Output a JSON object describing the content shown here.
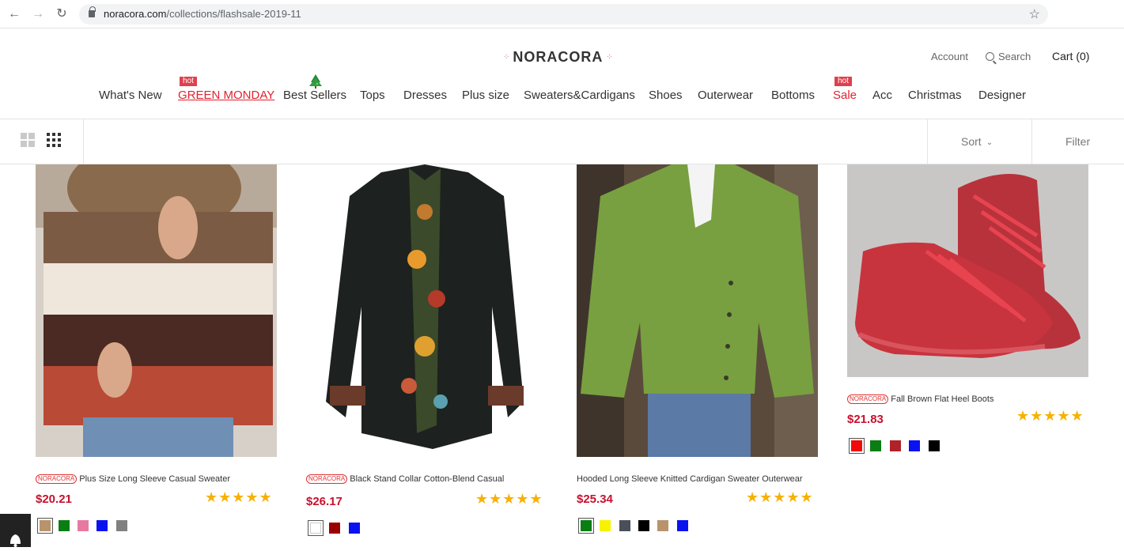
{
  "browser": {
    "url_host": "noracora.com",
    "url_path": "/collections/flashsale-2019-11"
  },
  "header": {
    "logo": "NORACORA",
    "account": "Account",
    "search": "Search",
    "cart": "Cart (0)"
  },
  "nav": [
    {
      "label": "What's New"
    },
    {
      "label": "GREEN MONDAY",
      "badge": "hot"
    },
    {
      "label": "Best Sellers"
    },
    {
      "label": "Tops"
    },
    {
      "label": "Dresses"
    },
    {
      "label": "Plus size"
    },
    {
      "label": "Sweaters&Cardigans"
    },
    {
      "label": "Shoes"
    },
    {
      "label": "Outerwear"
    },
    {
      "label": "Bottoms"
    },
    {
      "label": "Sale",
      "badge": "hot"
    },
    {
      "label": "Acc"
    },
    {
      "label": "Christmas"
    },
    {
      "label": "Designer"
    }
  ],
  "toolbar": {
    "sort": "Sort",
    "filter": "Filter"
  },
  "products": [
    {
      "brand": "NORACORA",
      "title": "Plus Size Long Sleeve Casual Sweater",
      "price": "$20.21",
      "rating": 5,
      "swatches": [
        "#b8936b",
        "#0a7d13",
        "#e87aa2",
        "#0a12f0",
        "#808080"
      ]
    },
    {
      "brand": "NORACORA",
      "title": "Black Stand Collar Cotton-Blend Casual",
      "price": "$26.17",
      "rating": 5,
      "swatches": [
        "#ffffff",
        "#9b0000",
        "#0a12f0"
      ]
    },
    {
      "brand": "",
      "title": "Hooded Long Sleeve Knitted Cardigan Sweater Outerwear",
      "price": "$25.34",
      "rating": 5,
      "swatches": [
        "#0a7d13",
        "#f7f200",
        "#4a4f59",
        "#000000",
        "#b8936b",
        "#0a12f0"
      ]
    },
    {
      "brand": "NORACORA",
      "title": "Fall Brown Flat Heel Boots",
      "price": "$21.83",
      "rating": 5,
      "swatches": [
        "#f20a0a",
        "#0a7d13",
        "#b0222a",
        "#0a12f0",
        "#000000"
      ]
    }
  ],
  "stars_text": "★★★★★"
}
